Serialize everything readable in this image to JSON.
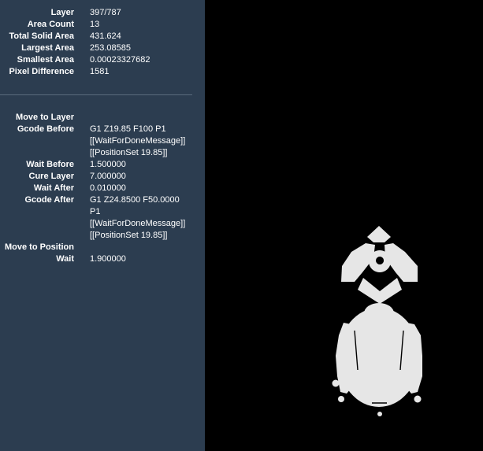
{
  "layer_info": {
    "layer_label": "Layer",
    "layer_value": "397/787",
    "area_count_label": "Area Count",
    "area_count_value": "13",
    "total_solid_area_label": "Total Solid Area",
    "total_solid_area_value": "431.624",
    "largest_area_label": "Largest Area",
    "largest_area_value": "253.08585",
    "smallest_area_label": "Smallest Area",
    "smallest_area_value": "0.00023327682",
    "pixel_difference_label": "Pixel Difference",
    "pixel_difference_value": "1581"
  },
  "gcode_info": {
    "move_to_layer_label": "Move to Layer",
    "gcode_before_label": "Gcode Before",
    "gcode_before_lines": [
      "G1 Z19.85 F100 P1",
      "[[WaitForDoneMessage]]",
      "[[PositionSet 19.85]]"
    ],
    "wait_before_label": "Wait Before",
    "wait_before_value": "1.500000",
    "cure_layer_label": "Cure Layer",
    "cure_layer_value": "7.000000",
    "wait_after_label": "Wait After",
    "wait_after_value": "0.010000",
    "gcode_after_label": "Gcode After",
    "gcode_after_lines": [
      "G1 Z24.8500 F50.0000",
      "P1",
      "[[WaitForDoneMessage]]",
      "[[PositionSet 19.85]]"
    ],
    "move_to_position_label": "Move to Position",
    "wait_label": "Wait",
    "wait_value": "1.900000"
  },
  "preview": {
    "background_color": "#000000",
    "solid_color": "#e6e6e6"
  }
}
